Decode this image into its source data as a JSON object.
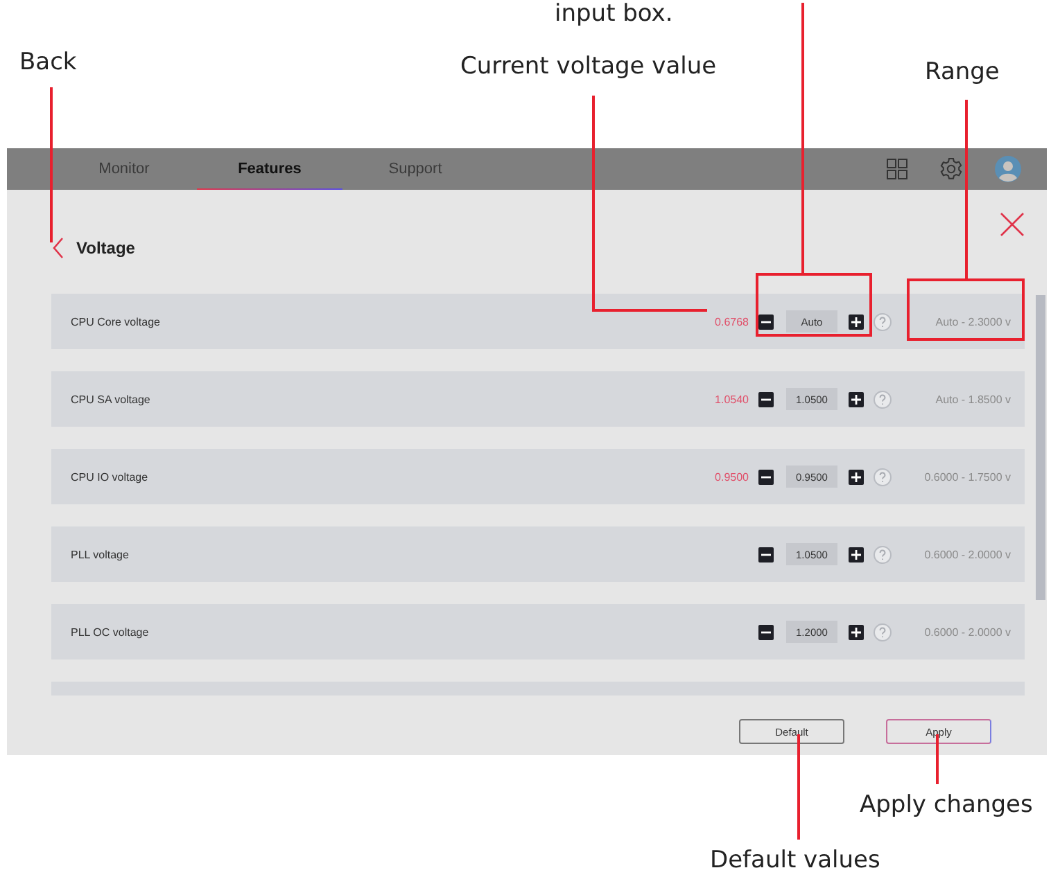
{
  "callouts": [
    {
      "text": "input box."
    },
    {
      "text": "Back"
    },
    {
      "text": "Current voltage value"
    },
    {
      "text": "Range"
    },
    {
      "text": "Apply changes"
    },
    {
      "text": "Default values"
    }
  ],
  "header": {
    "tabs": [
      {
        "label": "Monitor",
        "selected": false
      },
      {
        "label": "Features",
        "selected": true
      },
      {
        "label": "Support",
        "selected": false
      }
    ]
  },
  "page": {
    "title": "Voltage"
  },
  "rows": [
    {
      "kind": "setting",
      "name": "CPU Core voltage",
      "current": "0.6768",
      "value": "Auto",
      "range": "Auto - 2.3000 v"
    },
    {
      "kind": "setting",
      "name": "CPU SA voltage",
      "current": "1.0540",
      "value": "1.0500",
      "range": "Auto - 1.8500 v"
    },
    {
      "kind": "setting",
      "name": "CPU IO voltage",
      "current": "0.9500",
      "value": "0.9500",
      "range": "0.6000 - 1.7500 v"
    },
    {
      "kind": "setting",
      "name": "PLL voltage",
      "value": "1.0500",
      "range": "0.6000 - 2.0000 v"
    },
    {
      "kind": "setting",
      "name": "PLL OC voltage",
      "value": "1.2000",
      "range": "0.6000 - 2.0000 v"
    },
    {
      "kind": "cut_off"
    }
  ],
  "buttons": [
    {
      "label": "Default",
      "kind": "default"
    },
    {
      "label": "Apply",
      "kind": "apply"
    }
  ]
}
